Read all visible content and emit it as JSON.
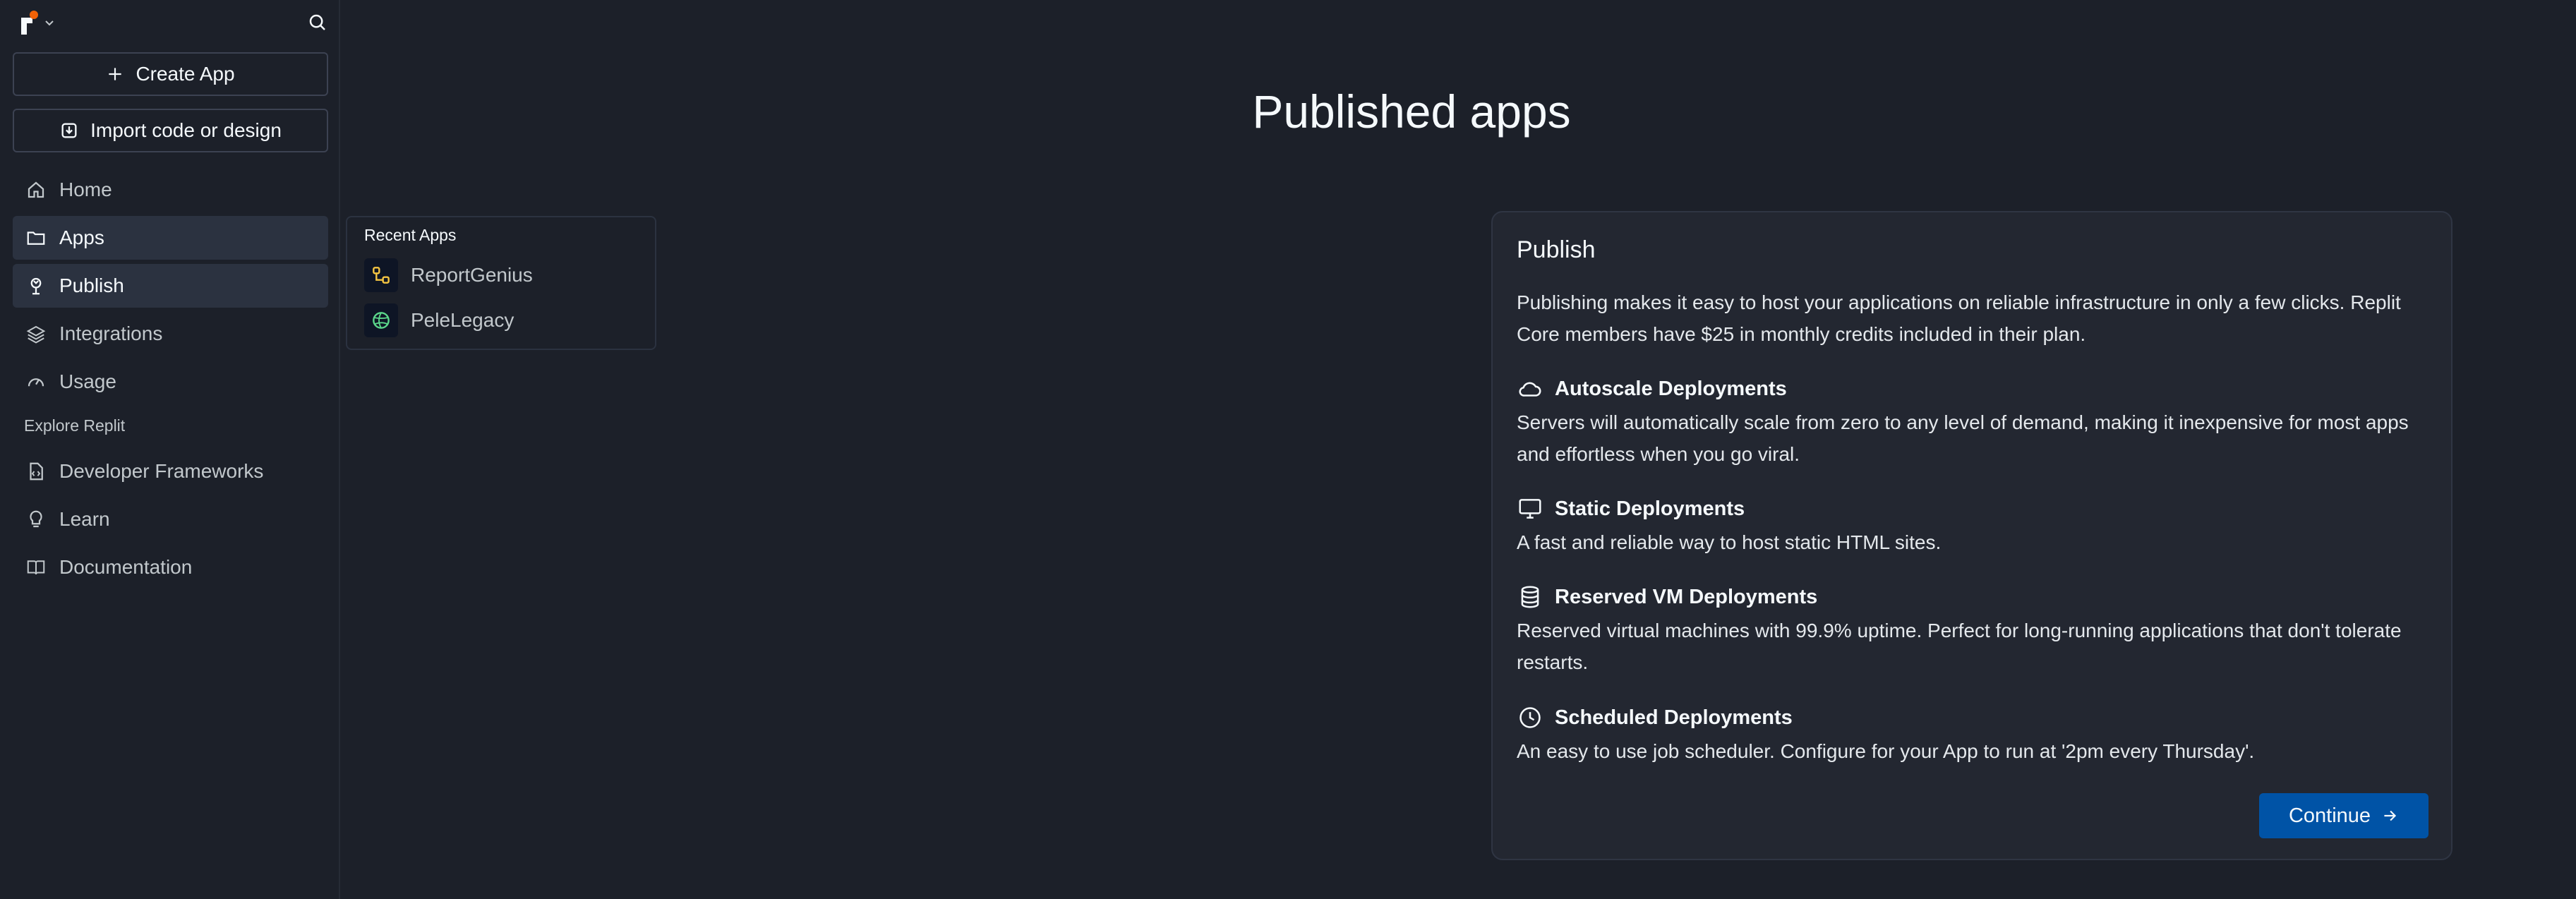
{
  "sidebar": {
    "create_app_label": "Create App",
    "import_label": "Import code or design",
    "nav": [
      {
        "label": "Home",
        "icon": "home-icon"
      },
      {
        "label": "Apps",
        "icon": "folder-icon"
      },
      {
        "label": "Publish",
        "icon": "publish-icon"
      },
      {
        "label": "Integrations",
        "icon": "layers-icon"
      },
      {
        "label": "Usage",
        "icon": "gauge-icon"
      }
    ],
    "explore_label": "Explore Replit",
    "explore": [
      {
        "label": "Developer Frameworks",
        "icon": "file-code-icon"
      },
      {
        "label": "Learn",
        "icon": "lightbulb-icon"
      },
      {
        "label": "Documentation",
        "icon": "book-icon"
      }
    ]
  },
  "recent_apps": {
    "title": "Recent Apps",
    "items": [
      {
        "name": "ReportGenius",
        "icon_color": "#f5c542"
      },
      {
        "name": "PeleLegacy",
        "icon_color": "#5bd68a"
      }
    ]
  },
  "main": {
    "title": "Published apps"
  },
  "publish_panel": {
    "title": "Publish",
    "intro": "Publishing makes it easy to host your applications on reliable infrastructure in only a few clicks. Replit Core members have $25 in monthly credits included in their plan.",
    "deployments": [
      {
        "title": "Autoscale Deployments",
        "icon": "cloud-icon",
        "description": "Servers will automatically scale from zero to any level of demand, making it inexpensive for most apps and effortless when you go viral."
      },
      {
        "title": "Static Deployments",
        "icon": "monitor-icon",
        "description": "A fast and reliable way to host static HTML sites."
      },
      {
        "title": "Reserved VM Deployments",
        "icon": "database-icon",
        "description": "Reserved virtual machines with 99.9% uptime. Perfect for long-running applications that don't tolerate restarts."
      },
      {
        "title": "Scheduled Deployments",
        "icon": "clock-icon",
        "description": "An easy to use job scheduler. Configure for your App to run at '2pm every Thursday'."
      }
    ],
    "continue_label": "Continue"
  },
  "colors": {
    "background": "#1c2029",
    "panel": "#232731",
    "accent": "#0053a6",
    "brand": "#f26207"
  }
}
